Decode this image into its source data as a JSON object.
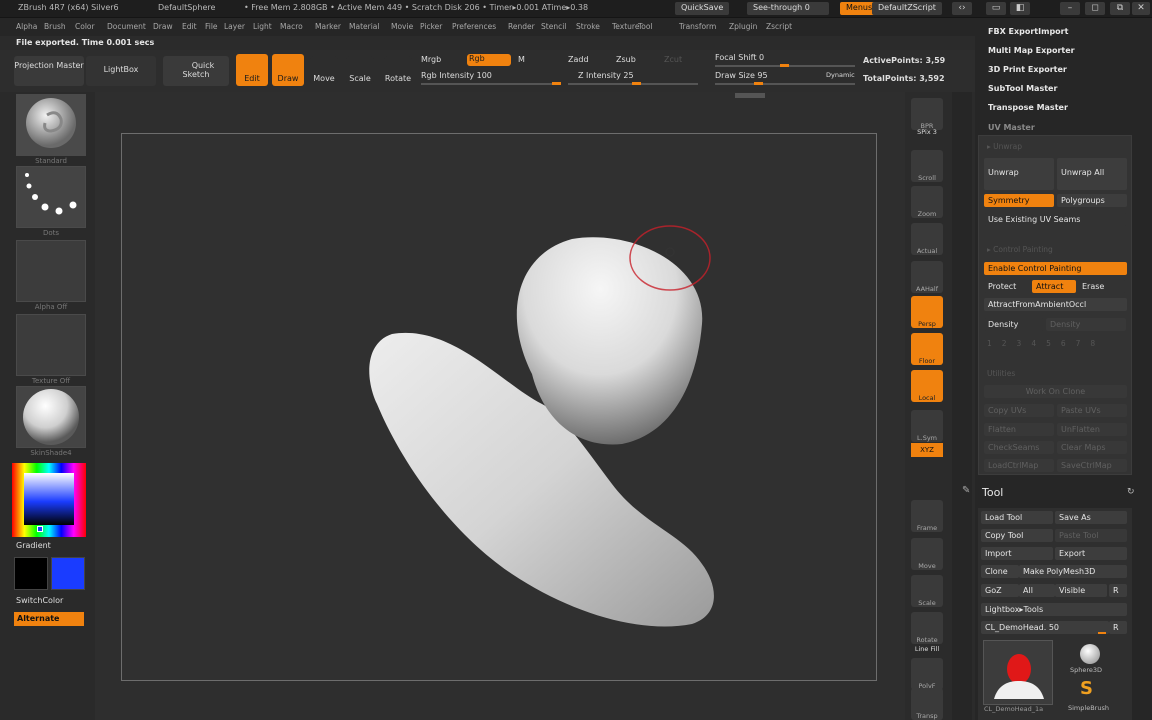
{
  "titlebar": {
    "app": "ZBrush 4R7 (x64) Silver6",
    "document": "DefaultSphere",
    "mem": "• Free Mem 2.808GB • Active Mem 449 • Scratch Disk 206 • Timer▸0.001 ATime▸0.38",
    "quicksave": "QuickSave",
    "seethrough": "See-through  0",
    "menus": "Menus",
    "script": "DefaultZScript"
  },
  "menubar": [
    "Alpha",
    "Brush",
    "Color",
    "Document",
    "Draw",
    "Edit",
    "File",
    "Layer",
    "Light",
    "Macro",
    "Marker",
    "Material",
    "Movie",
    "Picker",
    "Preferences",
    "Render",
    "Stencil",
    "Stroke",
    "Texture",
    "Tool",
    "Transform",
    "Zplugin",
    "Zscript"
  ],
  "status": "File exported. Time 0.001 secs",
  "shelf": {
    "projection_master": "Projection Master",
    "lightbox": "LightBox",
    "quick_sketch": "Quick Sketch",
    "edit": "Edit",
    "draw": "Draw",
    "move": "Move",
    "scale": "Scale",
    "rotate": "Rotate",
    "mrgb": "Mrgb",
    "rgb": "Rgb",
    "m": "M",
    "rgb_intensity": "Rgb Intensity 100",
    "zadd": "Zadd",
    "zsub": "Zsub",
    "zcut": "Zcut",
    "z_intensity": "Z Intensity 25",
    "focal_shift": "Focal Shift 0",
    "draw_size": "Draw Size 95",
    "dynamic": "Dynamic",
    "active_points": "ActivePoints: 3,59",
    "total_points": "TotalPoints: 3,592"
  },
  "leftpanel": {
    "brush_label": "Standard",
    "stroke_label": "Dots",
    "alpha_label": "Alpha Off",
    "texture_label": "Texture Off",
    "material_label": "SkinShade4",
    "gradient": "Gradient",
    "switchcolor": "SwitchColor",
    "alternate": "Alternate"
  },
  "rightstrip": [
    "BPR",
    "SPix 3",
    "Scroll",
    "Zoom",
    "Actual",
    "AAHalf",
    "Persp",
    "Floor",
    "Local",
    "L.Sym",
    "XYZ",
    "Frame",
    "Move",
    "Scale",
    "Rotate",
    "Line Fill",
    "PolyF",
    "Transp"
  ],
  "plugins": [
    "FBX ExportImport",
    "Multi Map Exporter",
    "3D Print Exporter",
    "SubTool Master",
    "Transpose Master",
    "UV Master"
  ],
  "uvmaster": {
    "unwrap": "Unwrap",
    "unwrap_all": "Unwrap All",
    "symmetry": "Symmetry",
    "polygroups": "Polygroups",
    "use_existing": "Use Existing UV Seams",
    "enable_control": "Enable Control Painting",
    "protect": "Protect",
    "attract": "Attract",
    "erase": "Erase",
    "attract_ao": "AttractFromAmbientOccl",
    "density": "Density",
    "density_value": "Density",
    "utilities": "Utilities",
    "copy_uvs": "Copy UVs",
    "paste_uvs": "Paste UVs",
    "flatten": "Flatten",
    "unflatten": "UnFlatten",
    "check_seams": "CheckSeams",
    "clear_maps": "Clear Maps",
    "load_ctrl": "LoadCtrlMap",
    "save_ctrl": "SaveCtrlMap",
    "work_on_clone": "Work On Clone"
  },
  "tool": {
    "title": "Tool",
    "load_tool": "Load Tool",
    "save_as": "Save As",
    "copy_tool": "Copy Tool",
    "paste_tool": "Paste Tool",
    "import": "Import",
    "export": "Export",
    "clone": "Clone",
    "make_polymesh": "Make PolyMesh3D",
    "goz": "GoZ",
    "all": "All",
    "visible": "Visible",
    "r": "R",
    "lightbox_tools": "Lightbox▸Tools",
    "current": "CL_DemoHead. 50",
    "sphere3d": "Sphere3D",
    "simplebrush": "SimpleBrush",
    "demohead_label": "CL_DemoHead_1a"
  },
  "colors": {
    "accent": "#f0820f",
    "primary": "#000000",
    "secondary": "#1a3cff"
  }
}
